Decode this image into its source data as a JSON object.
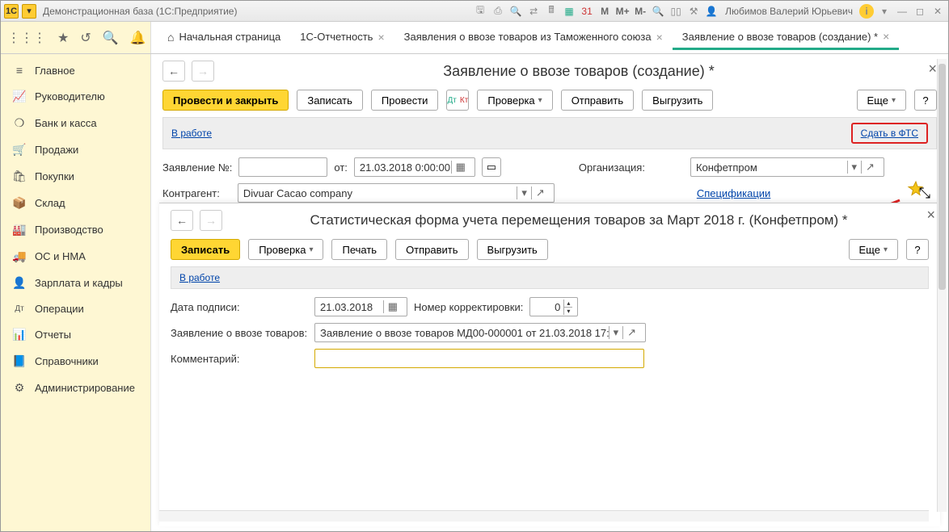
{
  "titlebar": {
    "logo": "1C",
    "title": "Демонстрационная база  (1С:Предприятие)",
    "memory_buttons": [
      "M",
      "M+",
      "M-"
    ],
    "user": "Любимов Валерий Юрьевич"
  },
  "tabs": {
    "home": "Начальная страница",
    "items": [
      {
        "label": "1С-Отчетность",
        "closable": true,
        "active": false
      },
      {
        "label": "Заявления о ввозе товаров из Таможенного союза",
        "closable": true,
        "active": false
      },
      {
        "label": "Заявление о ввозе товаров (создание) *",
        "closable": true,
        "active": true
      }
    ]
  },
  "sidebar": [
    {
      "icon": "≡",
      "label": "Главное"
    },
    {
      "icon": "📈",
      "label": "Руководителю"
    },
    {
      "icon": "❍",
      "label": "Банк и касса"
    },
    {
      "icon": "🛒",
      "label": "Продажи"
    },
    {
      "icon": "🛍",
      "label": "Покупки"
    },
    {
      "icon": "📦",
      "label": "Склад"
    },
    {
      "icon": "🏭",
      "label": "Производство"
    },
    {
      "icon": "🚚",
      "label": "ОС и НМА"
    },
    {
      "icon": "👤",
      "label": "Зарплата и кадры"
    },
    {
      "icon": "Дт",
      "label": "Операции"
    },
    {
      "icon": "📊",
      "label": "Отчеты"
    },
    {
      "icon": "📘",
      "label": "Справочники"
    },
    {
      "icon": "⚙",
      "label": "Администрирование"
    }
  ],
  "form1": {
    "title": "Заявление о ввозе товаров (создание) *",
    "btn_post_close": "Провести и закрыть",
    "btn_write": "Записать",
    "btn_post": "Провести",
    "btn_check": "Проверка",
    "btn_send": "Отправить",
    "btn_unload": "Выгрузить",
    "btn_more": "Еще",
    "status_link": "В работе",
    "status_action": "Сдать в ФТС",
    "label_number": "Заявление №:",
    "label_from": "от:",
    "date_value": "21.03.2018  0:00:00",
    "label_org": "Организация:",
    "org_value": "Конфетпром",
    "label_counterparty": "Контрагент:",
    "counterparty_value": "Divuar Cacao company",
    "spec_link": "Спецификации"
  },
  "form2": {
    "title": "Статистическая форма учета перемещения товаров за Март 2018 г. (Конфетпром) *",
    "btn_write": "Записать",
    "btn_check": "Проверка",
    "btn_print": "Печать",
    "btn_send": "Отправить",
    "btn_unload": "Выгрузить",
    "btn_more": "Еще",
    "status_link": "В работе",
    "label_sign_date": "Дата подписи:",
    "sign_date_value": "21.03.2018",
    "label_corr": "Номер корректировки:",
    "corr_value": "0",
    "label_statement": "Заявление о ввозе товаров:",
    "statement_value": "Заявление о ввозе товаров МД00-000001 от 21.03.2018 17:3",
    "label_comment": "Комментарий:",
    "comment_value": ""
  }
}
